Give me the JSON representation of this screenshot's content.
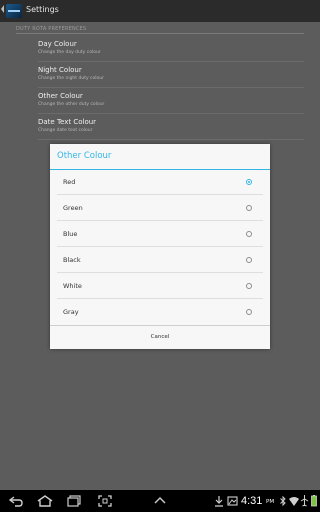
{
  "actionbar": {
    "title": "Settings"
  },
  "section": {
    "header": "DUTY ROTA PREFERENCES"
  },
  "preferences": [
    {
      "title": "Day Colour",
      "summary": "Change the day duty colour"
    },
    {
      "title": "Night Colour",
      "summary": "Change the night duty colour"
    },
    {
      "title": "Other Colour",
      "summary": "Change the other duty colour"
    },
    {
      "title": "Date Text Colour",
      "summary": "Change date text colour"
    }
  ],
  "dialog": {
    "title": "Other Colour",
    "options": [
      {
        "label": "Red",
        "checked": true
      },
      {
        "label": "Green",
        "checked": false
      },
      {
        "label": "Blue",
        "checked": false
      },
      {
        "label": "Black",
        "checked": false
      },
      {
        "label": "White",
        "checked": false
      },
      {
        "label": "Gray",
        "checked": false
      }
    ],
    "cancel_label": "Cancel"
  },
  "status": {
    "time": "4:31",
    "ampm": "PM"
  },
  "colors": {
    "accent": "#33b5e5",
    "actionbar": "#2b2b2b",
    "dim_background": "#5c5c5c"
  }
}
